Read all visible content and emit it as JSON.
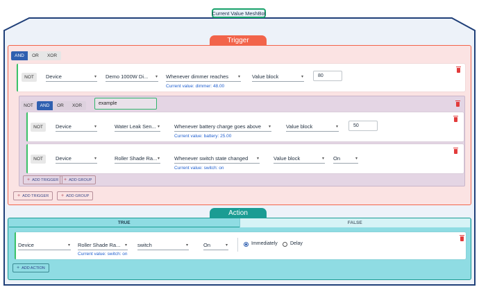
{
  "meshbot_title": "Current Value MeshBot",
  "trigger": {
    "label": "Trigger",
    "operators": [
      "AND",
      "OR",
      "XOR"
    ],
    "active_operator": "AND",
    "rows": [
      {
        "not_label": "NOT",
        "type": "Device",
        "device": "Demo 1000W Di...",
        "capability": "Whenever dimmer reaches",
        "comparator": "Value block",
        "value": "80",
        "current_value": "Current value: dimmer: 48.00"
      }
    ],
    "group": {
      "not_label": "NOT",
      "operators": [
        "AND",
        "OR",
        "XOR"
      ],
      "active_operator": "AND",
      "name": "example",
      "rows": [
        {
          "not_label": "NOT",
          "type": "Device",
          "device": "Water Leak Sen...",
          "capability": "Whenever battery charge goes above",
          "comparator": "Value block",
          "value": "50",
          "current_value": "Current value: battery: 25.00"
        },
        {
          "not_label": "NOT",
          "type": "Device",
          "device": "Roller Shade Ra...",
          "capability": "Whenever switch state changed",
          "comparator": "Value block",
          "value": "On",
          "current_value": "Current value: switch: on"
        }
      ],
      "add_trigger": "ADD TRIGGER",
      "add_group": "ADD GROUP"
    },
    "add_trigger": "ADD TRIGGER",
    "add_group": "ADD GROUP"
  },
  "action": {
    "label": "Action",
    "tabs": [
      "TRUE",
      "FALSE"
    ],
    "active_tab": "TRUE",
    "row": {
      "type": "Device",
      "device": "Roller Shade Ra...",
      "capability": "switch",
      "value": "On",
      "current_value": "Current value: switch: on",
      "timing_options": [
        "Immediately",
        "Delay"
      ],
      "selected_timing": "Immediately"
    },
    "add_action": "ADD ACTION"
  },
  "colors": {
    "trigger_accent": "#f2644a",
    "action_accent": "#1a9c93",
    "active_operator": "#2f5fb0",
    "current_value_text": "#1f5fcf",
    "delete_icon": "#e23b3b",
    "row_indicator": "#3cc36a"
  }
}
